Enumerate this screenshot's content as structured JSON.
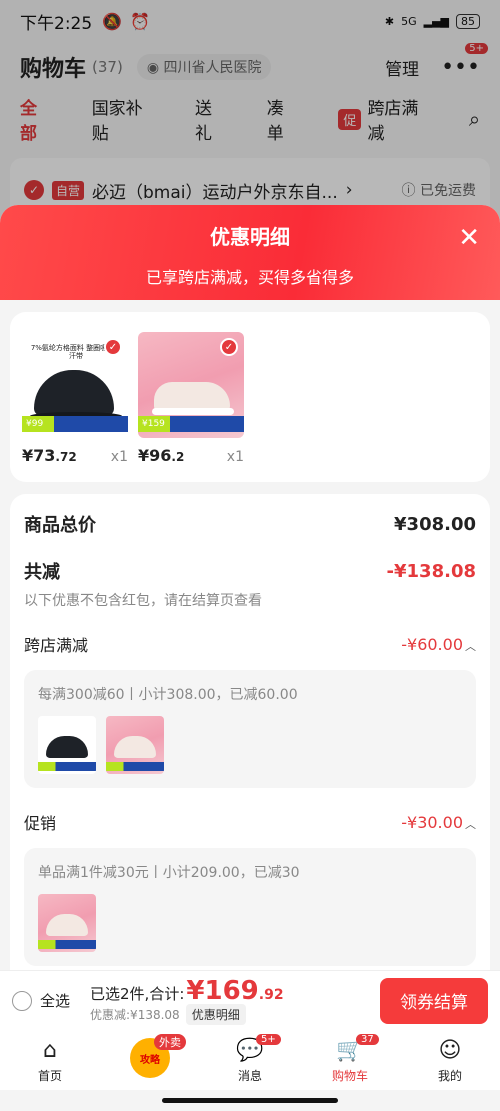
{
  "status_bar": {
    "time": "下午2:25",
    "net": "5G",
    "battery": "85"
  },
  "cart_header": {
    "title": "购物车",
    "count": "(37)",
    "location": "四川省人民医院",
    "manage": "管理",
    "more_badge": "5+"
  },
  "cart_tabs": [
    "全部",
    "国家补贴",
    "送礼",
    "凑单"
  ],
  "cart_promo_tab": {
    "tag": "促",
    "label": "跨店满减"
  },
  "store_row": {
    "tag": "自营",
    "name": "必迈（bmai）运动户外京东自...",
    "arrow": "›",
    "shipping": "已免运费"
  },
  "sheet": {
    "title": "优惠明细",
    "subtitle": "已享跨店满减，买得多省得多",
    "close_icon": "close-icon"
  },
  "products": [
    {
      "name": "cap",
      "thumb_text": "7%氨纶方格面料 整圈吸湿止汗带",
      "badge": "99",
      "price_main": "¥73",
      "price_cents": ".72",
      "qty": "x1"
    },
    {
      "name": "shoe",
      "thumb_text": "",
      "badge": "159",
      "price_main": "¥96",
      "price_cents": ".2",
      "qty": "x1"
    }
  ],
  "detail": {
    "total_label": "商品总价",
    "total_value": "¥308.00",
    "save_label": "共减",
    "save_value": "-¥138.08",
    "note": "以下优惠不包含红包，请在结算页查看",
    "sections": [
      {
        "label": "跨店满减",
        "value": "-¥60.00",
        "desc": "每满300减60丨小计308.00，已减60.00"
      },
      {
        "label": "促销",
        "value": "-¥30.00",
        "desc": "单品满1件减30元丨小计209.00，已减30"
      }
    ]
  },
  "checkout": {
    "select_all": "全选",
    "selected_text": "已选2件,合计:",
    "total_main": "¥169",
    "total_cents": ".92",
    "discount_text": "优惠减:¥138.08",
    "detail_button": "优惠明细",
    "pay_button": "领券结算"
  },
  "tabbar": [
    {
      "label": "首页",
      "icon": "home-icon",
      "badge": ""
    },
    {
      "label": "",
      "icon": "strategy-icon",
      "badge": "外卖",
      "inner": "攻略"
    },
    {
      "label": "消息",
      "icon": "message-icon",
      "badge": "5+"
    },
    {
      "label": "购物车",
      "icon": "cart-icon",
      "badge": "37"
    },
    {
      "label": "我的",
      "icon": "profile-icon",
      "badge": ""
    }
  ],
  "colors": {
    "accent": "#e4393c",
    "sheet_header": "#fa2c37"
  }
}
